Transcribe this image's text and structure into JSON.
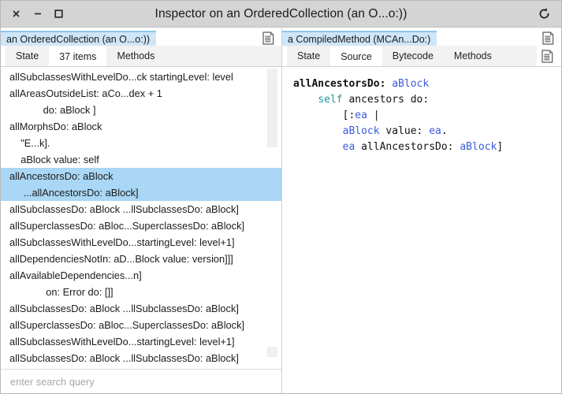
{
  "window": {
    "title": "Inspector on an OrderedCollection (an O...o:))",
    "controls": {
      "close": "×",
      "minimize": "−",
      "maximize": "□"
    },
    "refresh_icon": "refresh-ccw-icon"
  },
  "left_pane": {
    "object_tab": "an OrderedCollection (an O...o:))",
    "header_icon": "document-icon",
    "tabs": [
      {
        "label": "State",
        "selected": false
      },
      {
        "label": "37 items",
        "selected": true
      },
      {
        "label": "Methods",
        "selected": false
      }
    ],
    "items": [
      {
        "lines": [
          "allSubclassesWithLevelDo...ck startingLevel: level"
        ],
        "selected": false
      },
      {
        "lines": [
          "allAreasOutsideList: aCo...dex + 1",
          "            do: aBlock ]"
        ],
        "selected": false
      },
      {
        "lines": [
          "allMorphsDo: aBlock",
          "    \"E...k].",
          "    aBlock value: self"
        ],
        "selected": false
      },
      {
        "lines": [
          "allAncestorsDo: aBlock",
          "     ...allAncestorsDo: aBlock]"
        ],
        "selected": true
      },
      {
        "lines": [
          "allSubclassesDo: aBlock ...llSubclassesDo: aBlock]"
        ],
        "selected": false
      },
      {
        "lines": [
          "allSuperclassesDo: aBloc...SuperclassesDo: aBlock]"
        ],
        "selected": false
      },
      {
        "lines": [
          "allSubclassesWithLevelDo...startingLevel: level+1]"
        ],
        "selected": false
      },
      {
        "lines": [
          "allDependenciesNotIn: aD...Block value: version]]]"
        ],
        "selected": false
      },
      {
        "lines": [
          "allAvailableDependencies...n]",
          "             on: Error do: []]"
        ],
        "selected": false
      },
      {
        "lines": [
          "allSubclassesDo: aBlock ...llSubclassesDo: aBlock]"
        ],
        "selected": false
      },
      {
        "lines": [
          "allSuperclassesDo: aBloc...SuperclassesDo: aBlock]"
        ],
        "selected": false
      },
      {
        "lines": [
          "allSubclassesWithLevelDo...startingLevel: level+1]"
        ],
        "selected": false
      },
      {
        "lines": [
          "allSubclassesDo: aBlock ...llSubclassesDo: aBlock]"
        ],
        "selected": false
      }
    ],
    "search_placeholder": "enter search query",
    "search_value": ""
  },
  "right_pane": {
    "object_tab": "a CompiledMethod (MCAn...Do:)",
    "header_icon": "document-icon",
    "tabstrip_icon": "document-icon",
    "tabs": [
      {
        "label": "State",
        "selected": false
      },
      {
        "label": "Source",
        "selected": true
      },
      {
        "label": "Bytecode",
        "selected": false
      },
      {
        "label": "Methods",
        "selected": false
      }
    ],
    "source_code": "allAncestorsDo: aBlock\n    self ancestors do:\n        [:ea |\n        aBlock value: ea.\n        ea allAncestorsDo: aBlock]",
    "source_tokens": [
      [
        {
          "t": "allAncestorsDo:",
          "c": "sel"
        },
        {
          "t": " ",
          "c": "pun"
        },
        {
          "t": "aBlock",
          "c": "var"
        }
      ],
      [
        {
          "t": "    ",
          "c": "pun"
        },
        {
          "t": "self",
          "c": "kw"
        },
        {
          "t": " ancestors do:",
          "c": "pun"
        }
      ],
      [
        {
          "t": "        [:",
          "c": "pun"
        },
        {
          "t": "ea",
          "c": "var"
        },
        {
          "t": " |",
          "c": "pun"
        }
      ],
      [
        {
          "t": "        ",
          "c": "pun"
        },
        {
          "t": "aBlock",
          "c": "var"
        },
        {
          "t": " value: ",
          "c": "pun"
        },
        {
          "t": "ea",
          "c": "var"
        },
        {
          "t": ".",
          "c": "pun"
        }
      ],
      [
        {
          "t": "        ",
          "c": "pun"
        },
        {
          "t": "ea",
          "c": "var"
        },
        {
          "t": " allAncestorsDo: ",
          "c": "pun"
        },
        {
          "t": "aBlock",
          "c": "var"
        },
        {
          "t": "]",
          "c": "pun"
        }
      ]
    ]
  },
  "colors": {
    "titlebar_bg": "#d4d4d4",
    "object_tab_bg": "#cfe6f8",
    "object_tab_border": "#8fc4ea",
    "selection_bg": "#a9d7f5",
    "tab_inactive_bg": "#f2f2f2",
    "code_variable": "#3b5bdb",
    "code_keyword": "#1a9a9a",
    "scrollbar_thumb": "#efefef"
  }
}
